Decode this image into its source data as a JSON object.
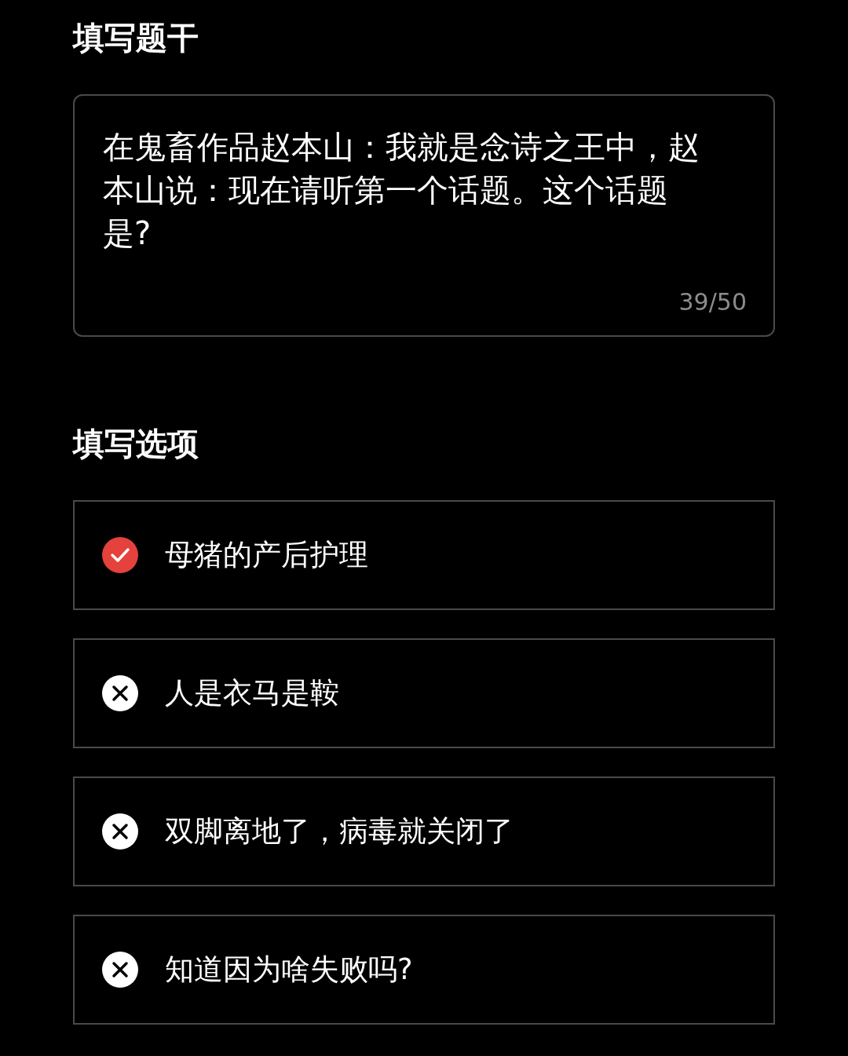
{
  "stem_section": {
    "title": "填写题干",
    "stem": "在鬼畜作品赵本山：我就是念诗之王中，赵本山说：现在请听第一个话题。这个话题是?",
    "counter": "39/50"
  },
  "options_section": {
    "title": "填写选项",
    "options": [
      {
        "text": "母猪的产后护理",
        "correct": true
      },
      {
        "text": "人是衣马是鞍",
        "correct": false
      },
      {
        "text": "双脚离地了，病毒就关闭了",
        "correct": false
      },
      {
        "text": "知道因为啥失败吗?",
        "correct": false
      }
    ]
  }
}
